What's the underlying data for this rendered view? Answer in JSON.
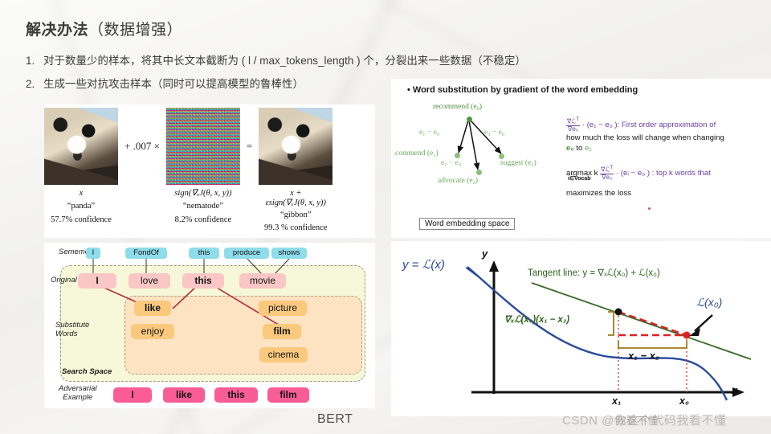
{
  "slide": {
    "title_bold": "解决办法",
    "title_rest": "（数据增强）",
    "bullets": [
      {
        "num": "1.",
        "text": "对于数量少的样本，将其中长文本截断为 ( l / max_tokens_length ) 个，分裂出来一些数据（不稳定）"
      },
      {
        "num": "2.",
        "text": "生成一些对抗攻击样本（同时可以提高模型的鲁棒性）"
      }
    ]
  },
  "fgsm": {
    "columns": [
      {
        "image": "panda-photo",
        "math": "x",
        "label": "“panda”",
        "confidence": "57.7% confidence"
      },
      {
        "image": "gradient-noise",
        "math": "sign(∇ₓJ(θ, x, y))",
        "label": "“nematode”",
        "confidence": "8.2% confidence"
      },
      {
        "image": "adversarial-panda",
        "math_line1": "x +",
        "math_line2": "εsign(∇ₓJ(θ, x, y))",
        "label": "“gibbon”",
        "confidence": "99.3 % confidence"
      }
    ],
    "op_plus": "+ .007 ×",
    "op_equals": "="
  },
  "embedding": {
    "bullet": "• Word substitution by gradient of the word embedding",
    "nodes": [
      {
        "label": "recommend (e₀)",
        "name": "node-recommend"
      },
      {
        "label": "commend (e₁)",
        "name": "node-commend"
      },
      {
        "label": "advocate (e₂)",
        "name": "node-advocate"
      },
      {
        "label": "suggest (e₃)",
        "name": "node-suggest"
      }
    ],
    "diffs": [
      "e₁ − e₀",
      "e₂ − e₀",
      "e₃ − e₀"
    ],
    "space_label": "Word embedding space",
    "math": {
      "line1_a": "· (e₁ − e₀ ): First order approximation of",
      "line2": "how much the loss will change when changing",
      "line3_a": "e₀",
      "line3_b": "to",
      "line3_c": "e₁",
      "argmax": "argmax k",
      "argmax_sub": "i∈Vocab",
      "line4_a": "· (eᵢ − e₀ ) :  top  k  words  that",
      "line5": "maximizes the loss",
      "frac_num": "∇ℒ",
      "frac_num_sup": "T",
      "frac_den": "∇e₀"
    }
  },
  "bert": {
    "row_labels": {
      "sememes": "Sememes",
      "original": "Original Input",
      "substitute_1": "Substitute",
      "substitute_2": "Words",
      "search_space": "Search Space",
      "adversarial_1": "Adversarial",
      "adversarial_2": "Example"
    },
    "sememes": [
      "I",
      "FondOf",
      "this",
      "produce",
      "shows"
    ],
    "original": [
      "I",
      "love",
      "this",
      "movie"
    ],
    "substitutes": [
      "like",
      "enjoy",
      "picture",
      "film",
      "cinema"
    ],
    "adversarial": [
      "I",
      "like",
      "this",
      "film"
    ],
    "caption": "BERT"
  },
  "chart_data": {
    "type": "line",
    "title": "",
    "xlabel": "x",
    "ylabel": "y",
    "grid": false,
    "legend": "inline-annotations",
    "annotations": {
      "curve_label": "y = ℒ(x)",
      "tangent_label": "Tangent line: y = ∇ₓℒ(x₀) + ℒ(x₀)",
      "gradient_gap": "∇ₓℒ(x₀)(x₁ − x₂)",
      "delta_x": "x₁ − x₂",
      "point_label": "ℒ(x₀)",
      "tick_x1": "x₁",
      "tick_x0": "x₀"
    },
    "series": [
      {
        "name": "loss-curve",
        "color": "#2a4b9b",
        "x": [
          0,
          0.08,
          0.18,
          0.3,
          0.42,
          0.52,
          0.62,
          0.72,
          0.8,
          0.88,
          0.94,
          1.0
        ],
        "y": [
          0.93,
          0.8,
          0.66,
          0.51,
          0.4,
          0.34,
          0.31,
          0.33,
          0.4,
          0.52,
          0.66,
          0.84
        ]
      },
      {
        "name": "tangent-line",
        "color": "#3a6b2a",
        "x": [
          0.14,
          1.0
        ],
        "y": [
          0.76,
          0.33
        ]
      },
      {
        "name": "secant-line",
        "color": "#e02020",
        "x": [
          0.52,
          0.8
        ],
        "y": [
          0.6,
          0.46
        ]
      }
    ],
    "points": [
      {
        "name": "tangent-touch-x1",
        "x": 0.52,
        "y": 0.6,
        "color": "#111111"
      },
      {
        "name": "loss-at-x0",
        "x": 0.8,
        "y": 0.46,
        "color": "#e02020"
      }
    ],
    "xticks": {
      "values": [
        0.52,
        0.8
      ],
      "labels": [
        "x₁",
        "x₀"
      ]
    }
  },
  "watermark": {
    "text": "CSDN @你这个代码我看不懂",
    "overlay": "我看不懂"
  }
}
